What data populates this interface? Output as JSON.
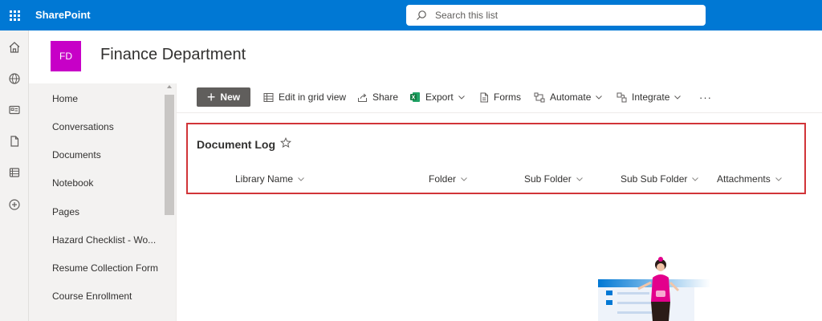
{
  "suitebar": {
    "brand": "SharePoint",
    "search_placeholder": "Search this list"
  },
  "appbar": {
    "items": [
      "home-icon",
      "globe-icon",
      "news-icon",
      "file-icon",
      "list-icon",
      "add-icon"
    ]
  },
  "site": {
    "logo_initials": "FD",
    "logo_color": "#c700c7",
    "title": "Finance Department"
  },
  "leftnav": {
    "items": [
      {
        "label": "Home"
      },
      {
        "label": "Conversations"
      },
      {
        "label": "Documents"
      },
      {
        "label": "Notebook"
      },
      {
        "label": "Pages"
      },
      {
        "label": "Hazard Checklist - Wo..."
      },
      {
        "label": "Resume Collection Form"
      },
      {
        "label": "Course Enrollment"
      }
    ]
  },
  "commandbar": {
    "new_label": "New",
    "edit_grid_label": "Edit in grid view",
    "share_label": "Share",
    "export_label": "Export",
    "forms_label": "Forms",
    "automate_label": "Automate",
    "integrate_label": "Integrate",
    "more_label": "···"
  },
  "list": {
    "title": "Document Log",
    "columns": [
      {
        "label": "Library Name"
      },
      {
        "label": "Folder"
      },
      {
        "label": "Sub Folder"
      },
      {
        "label": "Sub Sub Folder"
      },
      {
        "label": "Attachments"
      }
    ]
  },
  "colors": {
    "suitebar": "#0078d4",
    "highlight": "#d13438",
    "new_button": "#605e5c",
    "excel_green": "#107c41"
  }
}
